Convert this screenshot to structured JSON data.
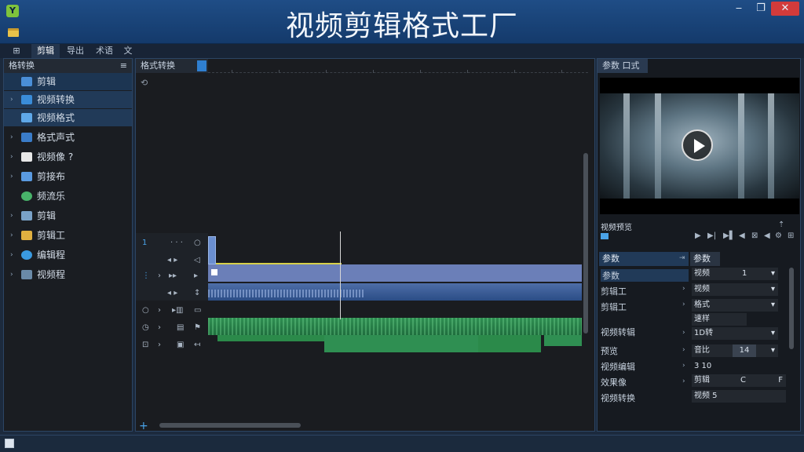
{
  "window": {
    "title": "视频剪辑格式工厂",
    "logo_letter": "Y",
    "min": "‒",
    "max": "❐",
    "close": "✕"
  },
  "tabs": [
    "剪辑",
    "导出",
    "术语",
    "文件"
  ],
  "left_panel": {
    "title": "格转换",
    "close": "≡",
    "items": [
      {
        "label": "剪辑",
        "color": "#4a8fd8"
      },
      {
        "label": "视频转换",
        "color": "#3a8cd8"
      },
      {
        "label": "视频格式",
        "color": "#5fa8e8"
      },
      {
        "label": "格式声式",
        "color": "#3a7cc8"
      },
      {
        "label": "视频像 ?",
        "color": "#e8e8e8"
      },
      {
        "label": "剪接布",
        "color": "#5a9ae0"
      },
      {
        "label": "频流乐",
        "color": "#48b36a"
      },
      {
        "label": "剪辑",
        "color": "#7aa2c8"
      },
      {
        "label": "剪辑工",
        "color": "#e0b040"
      },
      {
        "label": "编辑程",
        "color": "#3a9ae0"
      },
      {
        "label": "视频程",
        "color": "#6a8aa8"
      }
    ]
  },
  "timeline": {
    "title": "格式转换",
    "sub_icon": "⟲",
    "track_labels": [
      "1",
      "⋮",
      "○",
      "◷",
      "⊡"
    ]
  },
  "right_panel": {
    "tab": "参数 口式",
    "preview_caption": "视频预览",
    "preview_corner": "⇡",
    "controls": [
      "▶",
      "▶|",
      "▶▌",
      "◀",
      "⊠",
      "◀",
      "⚙",
      "⊞"
    ],
    "props_tabs": [
      "参数",
      "参数"
    ],
    "rows": [
      {
        "label": "参数",
        "value": "视频",
        "value2": "1"
      },
      {
        "label": "剪辑工",
        "value": "视频"
      },
      {
        "label": "剪辑工",
        "value": "格式"
      },
      {
        "label": "",
        "value": "速样"
      },
      {
        "label": "视频转辑",
        "value": "1D转"
      },
      {
        "label": "预览",
        "value": "音比",
        "value2": "14"
      },
      {
        "label": "视频编辑",
        "value": "3 10"
      },
      {
        "label": "效果像",
        "value": "剪辑",
        "value2": "C"
      },
      {
        "label": "视频转换",
        "value": "视频 5"
      }
    ]
  },
  "colors": {
    "accent": "#4aa3e8",
    "title_bar": "#1f4d86",
    "video_track": "#6b7fb8",
    "audio_track": "#2f8f52",
    "selection": "#d7d04a"
  }
}
